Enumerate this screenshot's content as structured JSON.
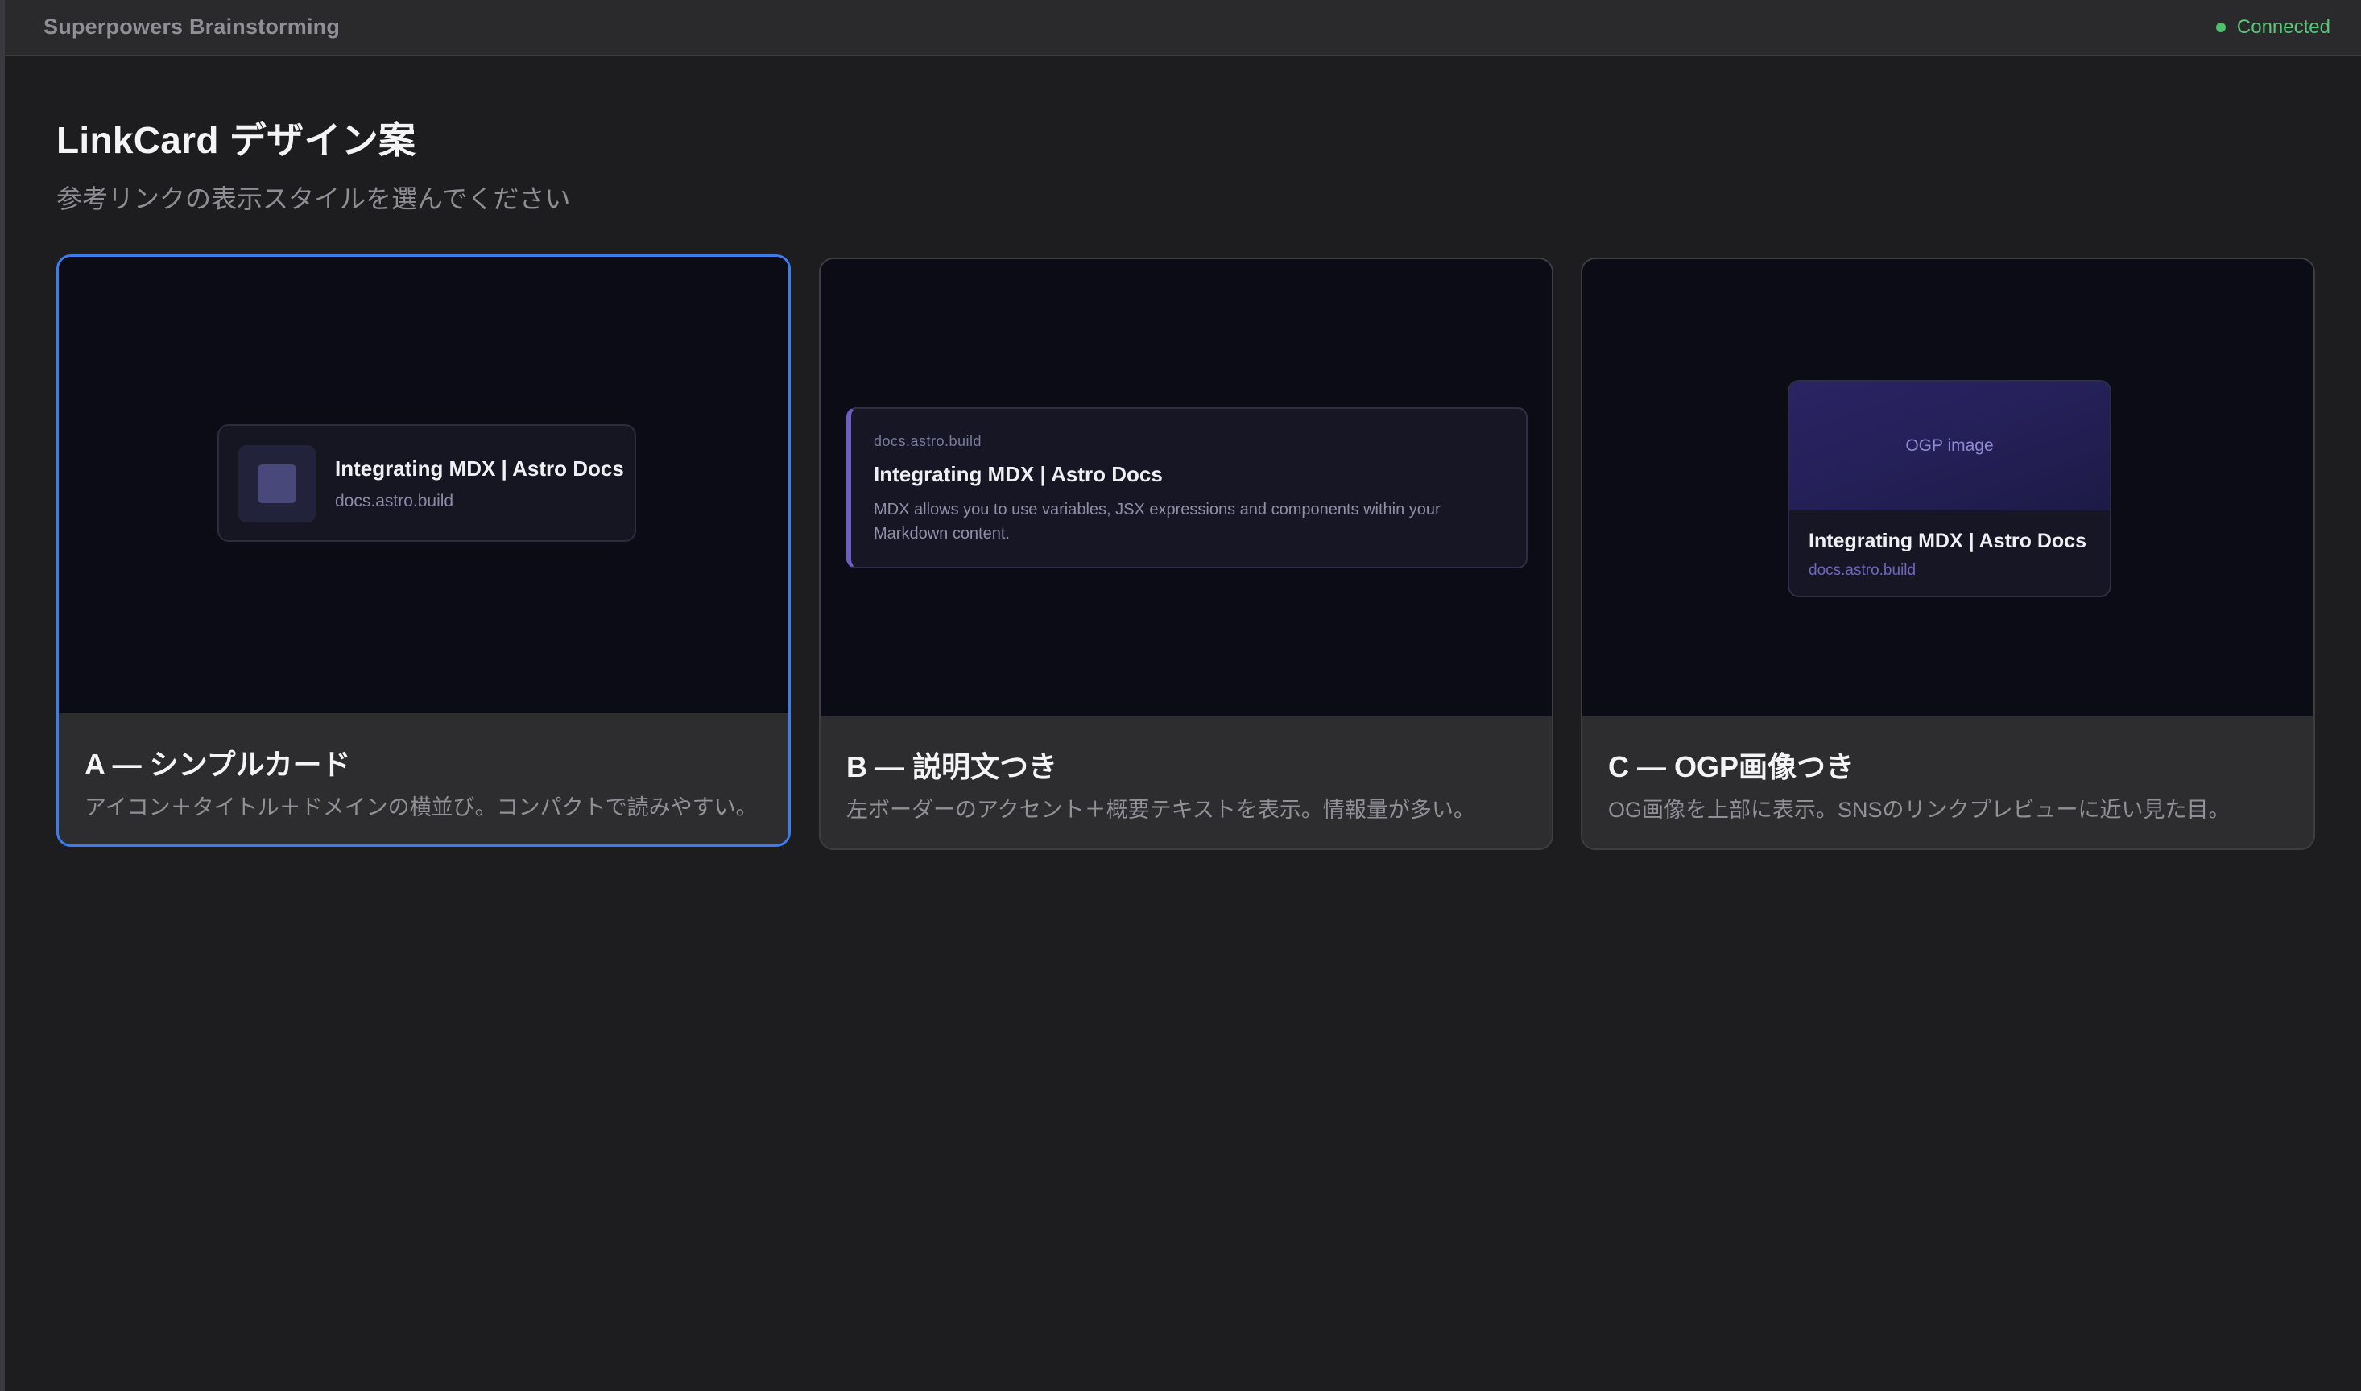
{
  "header": {
    "app_title": "Superpowers Brainstorming",
    "status_text": "Connected",
    "status_color": "#4cc36a"
  },
  "page": {
    "title": "LinkCard デザイン案",
    "subtitle": "参考リンクの表示スタイルを選んでください"
  },
  "accent_color": "#3b7ded",
  "options": [
    {
      "label": "A — シンプルカード",
      "description": "アイコン＋タイトル＋ドメインの横並び。コンパクトで読みやすい。",
      "selected": true,
      "preview": {
        "title": "Integrating MDX | Astro Docs",
        "domain": "docs.astro.build"
      }
    },
    {
      "label": "B — 説明文つき",
      "description": "左ボーダーのアクセント＋概要テキストを表示。情報量が多い。",
      "selected": false,
      "preview": {
        "domain": "docs.astro.build",
        "title": "Integrating MDX | Astro Docs",
        "text": "MDX allows you to use variables, JSX expressions and components within your Markdown content."
      }
    },
    {
      "label": "C — OGP画像つき",
      "description": "OG画像を上部に表示。SNSのリンクプレビューに近い見た目。",
      "selected": false,
      "preview": {
        "image_label": "OGP image",
        "title": "Integrating MDX | Astro Docs",
        "domain": "docs.astro.build"
      }
    }
  ]
}
